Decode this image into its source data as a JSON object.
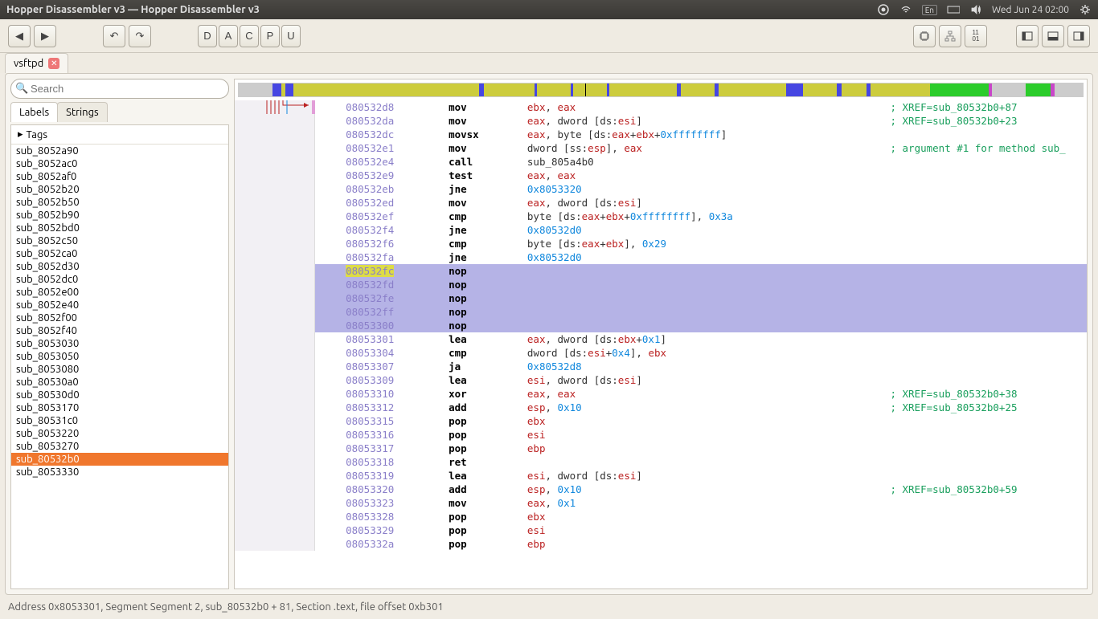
{
  "menubar": {
    "title": "Hopper Disassembler v3 — Hopper Disassembler v3",
    "time": "Wed Jun 24 02:00",
    "lang": "En"
  },
  "toolbar": {
    "letters": [
      "D",
      "A",
      "C",
      "P",
      "U"
    ]
  },
  "tab": {
    "name": "vsftpd"
  },
  "search": {
    "placeholder": "Search"
  },
  "sidetabs": {
    "labels": "Labels",
    "strings": "Strings"
  },
  "tags_label": "Tags",
  "labels": [
    "sub_8052a90",
    "sub_8052ac0",
    "sub_8052af0",
    "sub_8052b20",
    "sub_8052b50",
    "sub_8052b90",
    "sub_8052bd0",
    "sub_8052c50",
    "sub_8052ca0",
    "sub_8052d30",
    "sub_8052dc0",
    "sub_8052e00",
    "sub_8052e40",
    "sub_8052f00",
    "sub_8052f40",
    "sub_8053030",
    "sub_8053050",
    "sub_8053080",
    "sub_80530a0",
    "sub_80530d0",
    "sub_8053170",
    "sub_80531c0",
    "sub_8053220",
    "sub_8053270",
    "sub_80532b0",
    "sub_8053330"
  ],
  "selected_label_index": 24,
  "status": "Address 0x8053301, Segment Segment 2, sub_80532b0 + 81, Section .text, file offset 0xb301",
  "disasm": [
    {
      "addr": "080532d8",
      "mnem": "mov",
      "args": [
        {
          "t": "reg",
          "v": "ebx"
        },
        {
          "t": "p",
          "v": ", "
        },
        {
          "t": "reg",
          "v": "eax"
        }
      ],
      "xref": "; XREF=sub_80532b0+87"
    },
    {
      "addr": "080532da",
      "mnem": "mov",
      "args": [
        {
          "t": "reg",
          "v": "eax"
        },
        {
          "t": "p",
          "v": ", dword [ds:"
        },
        {
          "t": "reg",
          "v": "esi"
        },
        {
          "t": "p",
          "v": "]"
        }
      ],
      "xref": "; XREF=sub_80532b0+23"
    },
    {
      "addr": "080532dc",
      "mnem": "movsx",
      "args": [
        {
          "t": "reg",
          "v": "eax"
        },
        {
          "t": "p",
          "v": ", byte [ds:"
        },
        {
          "t": "reg",
          "v": "eax"
        },
        {
          "t": "p",
          "v": "+"
        },
        {
          "t": "reg",
          "v": "ebx"
        },
        {
          "t": "p",
          "v": "+"
        },
        {
          "t": "num",
          "v": "0xffffffff"
        },
        {
          "t": "p",
          "v": "]"
        }
      ]
    },
    {
      "addr": "080532e1",
      "mnem": "mov",
      "args": [
        {
          "t": "p",
          "v": "dword [ss:"
        },
        {
          "t": "reg",
          "v": "esp"
        },
        {
          "t": "p",
          "v": "], "
        },
        {
          "t": "reg",
          "v": "eax"
        }
      ],
      "xref": "; argument #1 for method sub_"
    },
    {
      "addr": "080532e4",
      "mnem": "call",
      "args": [
        {
          "t": "p",
          "v": "sub_805a4b0"
        }
      ]
    },
    {
      "addr": "080532e9",
      "mnem": "test",
      "args": [
        {
          "t": "reg",
          "v": "eax"
        },
        {
          "t": "p",
          "v": ", "
        },
        {
          "t": "reg",
          "v": "eax"
        }
      ]
    },
    {
      "addr": "080532eb",
      "mnem": "jne",
      "args": [
        {
          "t": "num",
          "v": "0x8053320"
        }
      ]
    },
    {
      "addr": "080532ed",
      "mnem": "mov",
      "args": [
        {
          "t": "reg",
          "v": "eax"
        },
        {
          "t": "p",
          "v": ", dword [ds:"
        },
        {
          "t": "reg",
          "v": "esi"
        },
        {
          "t": "p",
          "v": "]"
        }
      ]
    },
    {
      "addr": "080532ef",
      "mnem": "cmp",
      "args": [
        {
          "t": "p",
          "v": "byte [ds:"
        },
        {
          "t": "reg",
          "v": "eax"
        },
        {
          "t": "p",
          "v": "+"
        },
        {
          "t": "reg",
          "v": "ebx"
        },
        {
          "t": "p",
          "v": "+"
        },
        {
          "t": "num",
          "v": "0xffffffff"
        },
        {
          "t": "p",
          "v": "], "
        },
        {
          "t": "num",
          "v": "0x3a"
        }
      ]
    },
    {
      "addr": "080532f4",
      "mnem": "jne",
      "args": [
        {
          "t": "num",
          "v": "0x80532d0"
        }
      ]
    },
    {
      "addr": "080532f6",
      "mnem": "cmp",
      "args": [
        {
          "t": "p",
          "v": "byte [ds:"
        },
        {
          "t": "reg",
          "v": "eax"
        },
        {
          "t": "p",
          "v": "+"
        },
        {
          "t": "reg",
          "v": "ebx"
        },
        {
          "t": "p",
          "v": "], "
        },
        {
          "t": "num",
          "v": "0x29"
        }
      ]
    },
    {
      "addr": "080532fa",
      "mnem": "jne",
      "args": [
        {
          "t": "num",
          "v": "0x80532d0"
        }
      ]
    },
    {
      "addr": "080532fc",
      "mnem": "nop",
      "args": [],
      "hl": 1,
      "cur": 1
    },
    {
      "addr": "080532fd",
      "mnem": "nop",
      "args": [],
      "hl": 1
    },
    {
      "addr": "080532fe",
      "mnem": "nop",
      "args": [],
      "hl": 1
    },
    {
      "addr": "080532ff",
      "mnem": "nop",
      "args": [],
      "hl": 1
    },
    {
      "addr": "08053300",
      "mnem": "nop",
      "args": [],
      "hl": 1
    },
    {
      "addr": "08053301",
      "mnem": "lea",
      "args": [
        {
          "t": "reg",
          "v": "eax"
        },
        {
          "t": "p",
          "v": ", dword [ds:"
        },
        {
          "t": "reg",
          "v": "ebx"
        },
        {
          "t": "p",
          "v": "+"
        },
        {
          "t": "num",
          "v": "0x1"
        },
        {
          "t": "p",
          "v": "]"
        }
      ]
    },
    {
      "addr": "08053304",
      "mnem": "cmp",
      "args": [
        {
          "t": "p",
          "v": "dword [ds:"
        },
        {
          "t": "reg",
          "v": "esi"
        },
        {
          "t": "p",
          "v": "+"
        },
        {
          "t": "num",
          "v": "0x4"
        },
        {
          "t": "p",
          "v": "], "
        },
        {
          "t": "reg",
          "v": "ebx"
        }
      ]
    },
    {
      "addr": "08053307",
      "mnem": "ja",
      "args": [
        {
          "t": "num",
          "v": "0x80532d8"
        }
      ]
    },
    {
      "addr": "08053309",
      "mnem": "lea",
      "args": [
        {
          "t": "reg",
          "v": "esi"
        },
        {
          "t": "p",
          "v": ", dword [ds:"
        },
        {
          "t": "reg",
          "v": "esi"
        },
        {
          "t": "p",
          "v": "]"
        }
      ]
    },
    {
      "addr": "08053310",
      "mnem": "xor",
      "args": [
        {
          "t": "reg",
          "v": "eax"
        },
        {
          "t": "p",
          "v": ", "
        },
        {
          "t": "reg",
          "v": "eax"
        }
      ],
      "xref": "; XREF=sub_80532b0+38"
    },
    {
      "addr": "08053312",
      "mnem": "add",
      "args": [
        {
          "t": "reg",
          "v": "esp"
        },
        {
          "t": "p",
          "v": ", "
        },
        {
          "t": "num",
          "v": "0x10"
        }
      ],
      "xref": "; XREF=sub_80532b0+25"
    },
    {
      "addr": "08053315",
      "mnem": "pop",
      "args": [
        {
          "t": "reg",
          "v": "ebx"
        }
      ]
    },
    {
      "addr": "08053316",
      "mnem": "pop",
      "args": [
        {
          "t": "reg",
          "v": "esi"
        }
      ]
    },
    {
      "addr": "08053317",
      "mnem": "pop",
      "args": [
        {
          "t": "reg",
          "v": "ebp"
        }
      ]
    },
    {
      "addr": "08053318",
      "mnem": "ret",
      "args": []
    },
    {
      "addr": "08053319",
      "mnem": "lea",
      "args": [
        {
          "t": "reg",
          "v": "esi"
        },
        {
          "t": "p",
          "v": ", dword [ds:"
        },
        {
          "t": "reg",
          "v": "esi"
        },
        {
          "t": "p",
          "v": "]"
        }
      ]
    },
    {
      "addr": "08053320",
      "mnem": "add",
      "args": [
        {
          "t": "reg",
          "v": "esp"
        },
        {
          "t": "p",
          "v": ", "
        },
        {
          "t": "num",
          "v": "0x10"
        }
      ],
      "xref": "; XREF=sub_80532b0+59"
    },
    {
      "addr": "08053323",
      "mnem": "mov",
      "args": [
        {
          "t": "reg",
          "v": "eax"
        },
        {
          "t": "p",
          "v": ", "
        },
        {
          "t": "num",
          "v": "0x1"
        }
      ]
    },
    {
      "addr": "08053328",
      "mnem": "pop",
      "args": [
        {
          "t": "reg",
          "v": "ebx"
        }
      ]
    },
    {
      "addr": "08053329",
      "mnem": "pop",
      "args": [
        {
          "t": "reg",
          "v": "esi"
        }
      ]
    },
    {
      "addr": "0805332a",
      "mnem": "pop",
      "args": [
        {
          "t": "reg",
          "v": "ebp"
        }
      ]
    }
  ]
}
